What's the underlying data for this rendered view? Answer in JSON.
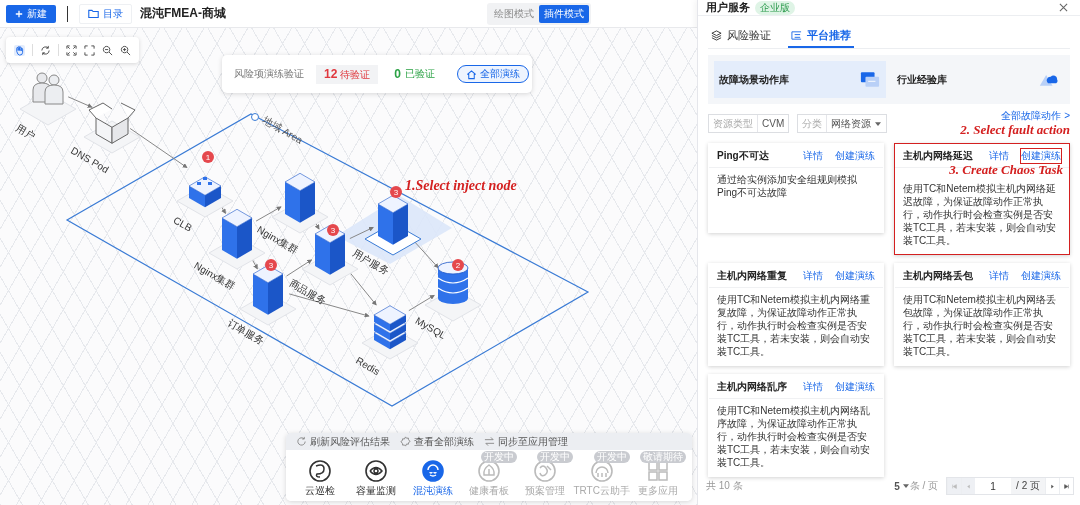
{
  "top_bar": {
    "new_button": "新建",
    "catalog_button": "目录",
    "title": "混沌FMEA-商城",
    "modes": [
      {
        "label": "绘图模式",
        "selected": false
      },
      {
        "label": "插件模式",
        "selected": true
      }
    ]
  },
  "canvas_tools": [
    {
      "kind": "hand",
      "selected": true
    },
    {
      "kind": "rotate",
      "selected": false
    },
    {
      "kind": "fit",
      "selected": false
    },
    {
      "kind": "fullscreen",
      "selected": false
    },
    {
      "kind": "zoom_out",
      "selected": false
    },
    {
      "kind": "zoom_in",
      "selected": false
    }
  ],
  "risk_summary": {
    "label": "风险项演练验证",
    "pending_count": "12",
    "pending_label": "待验证",
    "verified_count": "0",
    "verified_label": "已验证",
    "button": "全部演练"
  },
  "diagram": {
    "area_label": "地域 Area",
    "annotation": "1.Select inject node",
    "nodes": [
      {
        "kind": "users",
        "label": "用户",
        "selected": false
      },
      {
        "kind": "dns",
        "label": "DNS Pod",
        "selected": false
      },
      {
        "kind": "clb",
        "label": "CLB",
        "badge": "1",
        "selected": false
      },
      {
        "kind": "server",
        "label": "Nginx集群",
        "selected": false
      },
      {
        "kind": "server",
        "label": "Nginx集群",
        "selected": false
      },
      {
        "kind": "server",
        "label": "商品服务",
        "badge": "3",
        "selected": false
      },
      {
        "kind": "server",
        "label": "用户服务",
        "badge": "3",
        "selected": true
      },
      {
        "kind": "server",
        "label": "订单服务",
        "badge": "3",
        "selected": false
      },
      {
        "kind": "database",
        "label": "MySQL",
        "badge": "2",
        "selected": false
      },
      {
        "kind": "cache",
        "label": "Redis",
        "selected": false
      }
    ]
  },
  "bottom_bar": {
    "actions": [
      {
        "kind": "refresh",
        "label": "刷新风险评估结果"
      },
      {
        "kind": "settings",
        "label": "查看全部演练"
      },
      {
        "kind": "sync",
        "label": "同步至应用管理"
      }
    ],
    "apps": [
      {
        "label": "云巡检",
        "selected": false,
        "disabled": false
      },
      {
        "label": "容量监测",
        "selected": false,
        "disabled": false
      },
      {
        "label": "混沌演练",
        "selected": true,
        "disabled": false
      },
      {
        "label": "健康看板",
        "badge": "开发中",
        "selected": false,
        "disabled": true
      },
      {
        "label": "预案管理",
        "badge": "开发中",
        "selected": false,
        "disabled": true
      },
      {
        "label": "TRTC云助手",
        "badge": "开发中",
        "selected": false,
        "disabled": true
      },
      {
        "label": "更多应用",
        "badge": "敬请期待",
        "selected": false,
        "disabled": true
      }
    ]
  },
  "side_panel": {
    "title": "用户服务",
    "edition_badge": "企业版",
    "tabs": [
      {
        "label": "风险验证",
        "selected": false
      },
      {
        "label": "平台推荐",
        "selected": true
      }
    ],
    "libraries": [
      {
        "label": "故障场景动作库",
        "selected": true
      },
      {
        "label": "行业经验库",
        "selected": false
      }
    ],
    "filters": [
      {
        "label": "资源类型",
        "value": "CVM",
        "dropdown": false
      },
      {
        "label": "分类",
        "value": "网络资源",
        "dropdown": true
      }
    ],
    "annotation": "2. Select fault action",
    "all_actions_link": "全部故障动作 >",
    "cards": [
      {
        "title": "Ping不可达",
        "detail_link": "详情",
        "create_link": "创建演练",
        "description": "通过给实例添加安全组规则模拟Ping不可达故障",
        "highlighted": false
      },
      {
        "title": "主机内网络延迟",
        "detail_link": "详情",
        "create_link": "创建演练",
        "annotation": "3. Create Chaos Task",
        "description": "使用TC和Netem模拟主机内网络延迟故障，为保证故障动作正常执行，动作执行时会检查实例是否安装TC工具，若未安装，则会自动安装TC工具。",
        "highlighted": true
      },
      {
        "title": "主机内网络重复",
        "detail_link": "详情",
        "create_link": "创建演练",
        "description": "使用TC和Netem模拟主机内网络重复故障，为保证故障动作正常执行，动作执行时会检查实例是否安装TC工具，若未安装，则会自动安装TC工具。",
        "highlighted": false
      },
      {
        "title": "主机内网络丢包",
        "detail_link": "详情",
        "create_link": "创建演练",
        "description": "使用TC和Netem模拟主机内网络丢包故障，为保证故障动作正常执行，动作执行时会检查实例是否安装TC工具，若未安装，则会自动安装TC工具。",
        "highlighted": false
      },
      {
        "title": "主机内网络乱序",
        "detail_link": "详情",
        "create_link": "创建演练",
        "description": "使用TC和Netem模拟主机内网络乱序故障，为保证故障动作正常执行，动作执行时会检查实例是否安装TC工具，若未安装，则会自动安装TC工具。",
        "highlighted": false
      }
    ],
    "pagination": {
      "total": "共 10 条",
      "page_size": "5",
      "page_size_unit": "条 / 页",
      "page": "1",
      "page_count": "/ 2 页"
    }
  }
}
